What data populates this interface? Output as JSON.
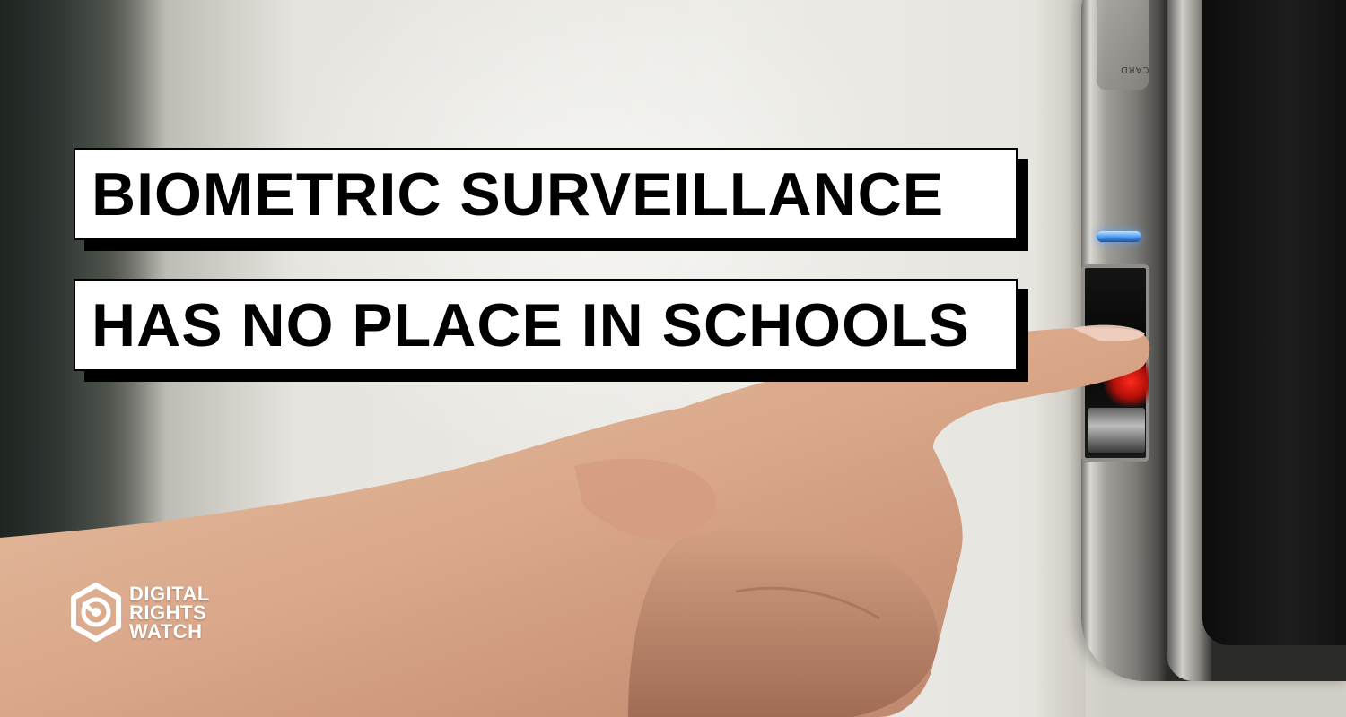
{
  "headline": {
    "line1": "BIOMETRIC SURVEILLANCE",
    "line2": "HAS NO PLACE IN SCHOOLS"
  },
  "device": {
    "card_label": "CARD"
  },
  "logo": {
    "line1": "DIGITAL",
    "line2": "RIGHTS",
    "line3": "WATCH"
  },
  "colors": {
    "headline_box": "#ffffff",
    "headline_text": "#000000",
    "box_shadow": "#000000",
    "logo": "#ffffff",
    "scanner_light": "#ff2a1c",
    "status_led": "#3f8fe8"
  },
  "icons": [
    "fingerprint-scanner",
    "hexagon-eye-logo"
  ]
}
